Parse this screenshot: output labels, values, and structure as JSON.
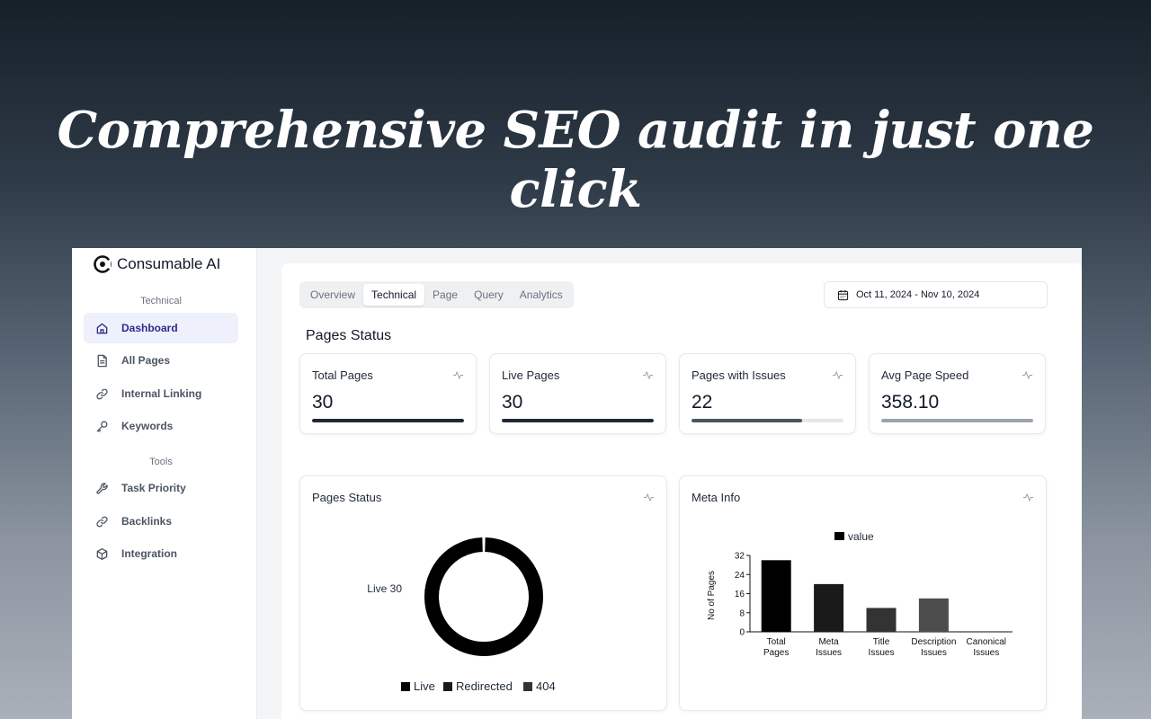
{
  "hero": {
    "headline": "Comprehensive SEO audit in just one click"
  },
  "brand": {
    "name": "Consumable AI"
  },
  "sidebar": {
    "section_technical": "Technical",
    "section_tools": "Tools",
    "technical_items": [
      {
        "label": "Dashboard",
        "icon": "home-icon",
        "active": true
      },
      {
        "label": "All Pages",
        "icon": "file-icon",
        "active": false
      },
      {
        "label": "Internal Linking",
        "icon": "link-icon",
        "active": false
      },
      {
        "label": "Keywords",
        "icon": "key-icon",
        "active": false
      }
    ],
    "tools_items": [
      {
        "label": "Task Priority",
        "icon": "wrench-icon"
      },
      {
        "label": "Backlinks",
        "icon": "link-icon"
      },
      {
        "label": "Integration",
        "icon": "cube-icon"
      }
    ]
  },
  "tabs": [
    {
      "label": "Overview",
      "active": false
    },
    {
      "label": "Technical",
      "active": true
    },
    {
      "label": "Page",
      "active": false
    },
    {
      "label": "Query",
      "active": false
    },
    {
      "label": "Analytics",
      "active": false
    }
  ],
  "date_range": "Oct 11, 2024 - Nov 10, 2024",
  "pages_status_title": "Pages Status",
  "stats": [
    {
      "label": "Total Pages",
      "value": "30",
      "progress": 1.0,
      "color": "#1f2937"
    },
    {
      "label": "Live Pages",
      "value": "30",
      "progress": 1.0,
      "color": "#1f2937"
    },
    {
      "label": "Pages with Issues",
      "value": "22",
      "progress": 0.73,
      "color": "#4b5563"
    },
    {
      "label": "Avg Page Speed",
      "value": "358.10",
      "progress": 1.0,
      "color": "#9ca3af"
    }
  ],
  "charts": {
    "pages_status": {
      "title": "Pages Status"
    },
    "meta_info": {
      "title": "Meta Info"
    }
  },
  "chart_data": [
    {
      "type": "pie",
      "title": "Pages Status",
      "categories": [
        "Live",
        "Redirected",
        "404"
      ],
      "values": [
        30,
        0,
        0
      ],
      "slice_labels": [
        "Live 30"
      ],
      "colors": [
        "#000000",
        "#1a1a1a",
        "#333333"
      ],
      "legend_position": "bottom"
    },
    {
      "type": "bar",
      "title": "Meta Info",
      "categories": [
        [
          "Total",
          "Pages"
        ],
        [
          "Meta",
          "Issues"
        ],
        [
          "Title",
          "Issues"
        ],
        [
          "Description",
          "Issues"
        ],
        [
          "Canonical",
          "Issues"
        ]
      ],
      "series": [
        {
          "name": "value",
          "values": [
            30,
            20,
            10,
            14,
            0
          ]
        }
      ],
      "colors": [
        "#000000",
        "#1a1a1a",
        "#333333",
        "#4d4d4d",
        "#666666"
      ],
      "ylabel": "No of Pages",
      "ylim": [
        0,
        32
      ],
      "yticks": [
        0,
        8,
        16,
        24,
        32
      ],
      "legend_position": "top"
    }
  ]
}
